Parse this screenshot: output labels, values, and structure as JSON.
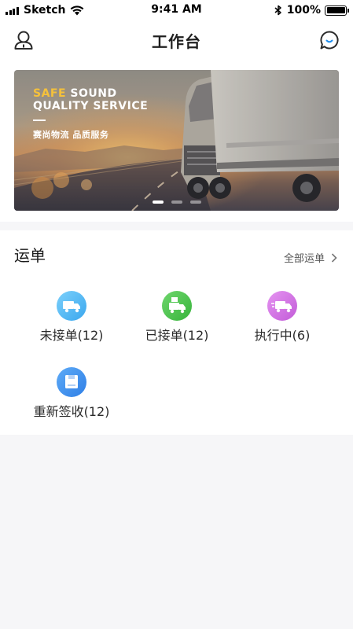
{
  "status_bar": {
    "carrier": "Sketch",
    "time": "9:41 AM",
    "battery": "100%",
    "battery_level": 1.0
  },
  "nav": {
    "title": "工作台",
    "left_icon": "user-icon",
    "right_icon": "message-icon"
  },
  "banner": {
    "tagline_accent": "SAFE",
    "tagline_rest": " SOUND",
    "tagline_line2": "QUALITY SERVICE",
    "subtitle": "赛尚物流  品质服务",
    "slides": 3,
    "active_slide": 1
  },
  "waybill": {
    "title": "运单",
    "view_all": "全部运单",
    "items": [
      {
        "label": "未接单(12)",
        "icon": "truck-icon",
        "color": "#3aa7ee",
        "color_light": "#7cd0fb"
      },
      {
        "label": "已接单(12)",
        "icon": "loaded-truck-icon",
        "color": "#37b43b",
        "color_light": "#6fd66d"
      },
      {
        "label": "执行中(6)",
        "icon": "moving-truck-icon",
        "color": "#c25bd8",
        "color_light": "#e594f1"
      },
      {
        "label": "重新签收(12)",
        "icon": "package-icon",
        "color": "#2f7fe6",
        "color_light": "#5eabf7"
      }
    ]
  }
}
